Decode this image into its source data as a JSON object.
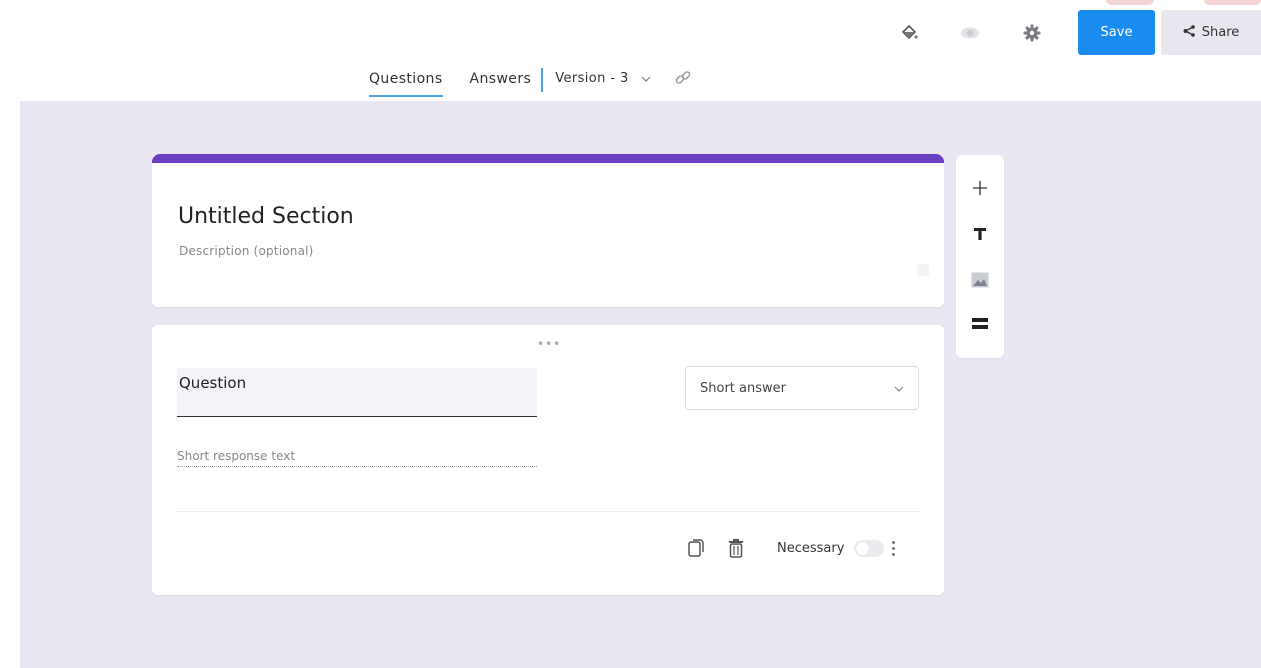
{
  "toolbar": {
    "icons": [
      "paint-bucket-icon",
      "eye-icon",
      "gear-icon"
    ],
    "save_label": "Save",
    "share_label": "Share",
    "accent": "#1a8cf0"
  },
  "tabs": {
    "questions": "Questions",
    "answers": "Answers",
    "version": "Version - 3"
  },
  "section": {
    "title": "Untitled Section",
    "description_placeholder": "Description (optional)",
    "accent": "#6a3fc1"
  },
  "question": {
    "title": "Question",
    "type": "Short answer",
    "response_placeholder": "Short response text",
    "required_label": "Necessary",
    "required": false
  },
  "side_toolbar": {
    "items": [
      "add-icon",
      "text-icon",
      "image-icon",
      "section-divider-icon"
    ]
  },
  "colors": {
    "canvas_bg": "#ebe7f2"
  }
}
